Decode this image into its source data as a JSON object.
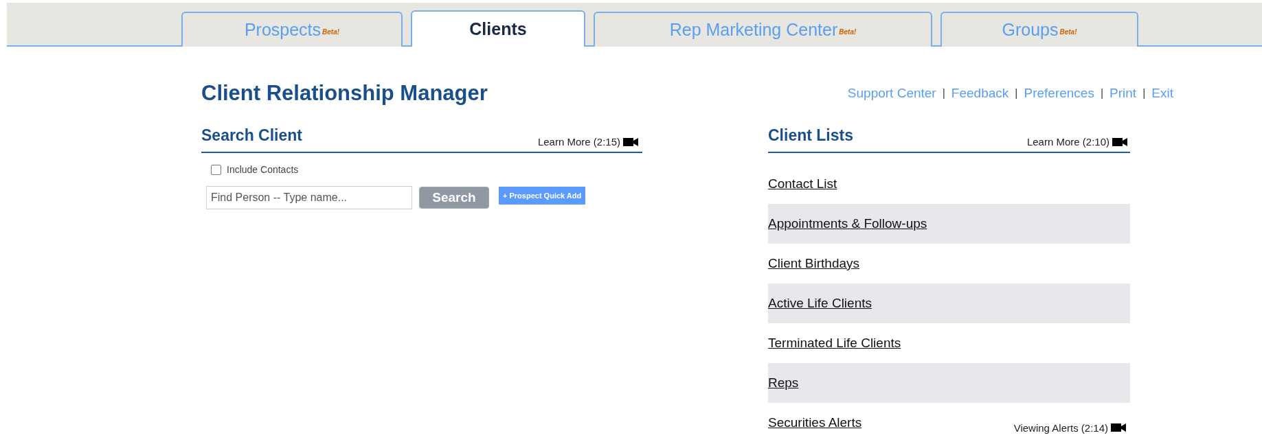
{
  "tabs": [
    {
      "label": "Prospects",
      "badge": "Beta!",
      "selected": false
    },
    {
      "label": "Clients",
      "selected": true
    },
    {
      "label": "Rep Marketing Center",
      "badge": "Beta!",
      "selected": false
    },
    {
      "label": "Groups",
      "badge": "Beta!",
      "selected": false
    }
  ],
  "title": "Client Relationship Manager",
  "top_links": {
    "separator": "|",
    "items": [
      "Support Center",
      "Feedback",
      "Preferences",
      "Print",
      "Exit"
    ]
  },
  "search_client": {
    "heading": "Search Client",
    "learn_more": "Learn More (2:15)",
    "include_contacts": {
      "label": "Include Contacts",
      "checked": false
    },
    "search_field": {
      "placeholder": "Find Person -- Type name..."
    },
    "search_button": {
      "label": "Search",
      "disabled": true
    },
    "quick_add_button": "+ Prospect Quick Add"
  },
  "client_lists": {
    "heading": "Client Lists",
    "learn_more": "Learn More (2:10)",
    "items": [
      {
        "label": "Contact List"
      },
      {
        "label": "Appointments & Follow-ups"
      },
      {
        "label": "Client Birthdays"
      },
      {
        "label": "Active Life Clients"
      },
      {
        "label": "Terminated Life Clients"
      },
      {
        "label": "Reps"
      },
      {
        "label": "Securities Alerts",
        "note": "Viewing Alerts (2:14)"
      }
    ]
  }
}
